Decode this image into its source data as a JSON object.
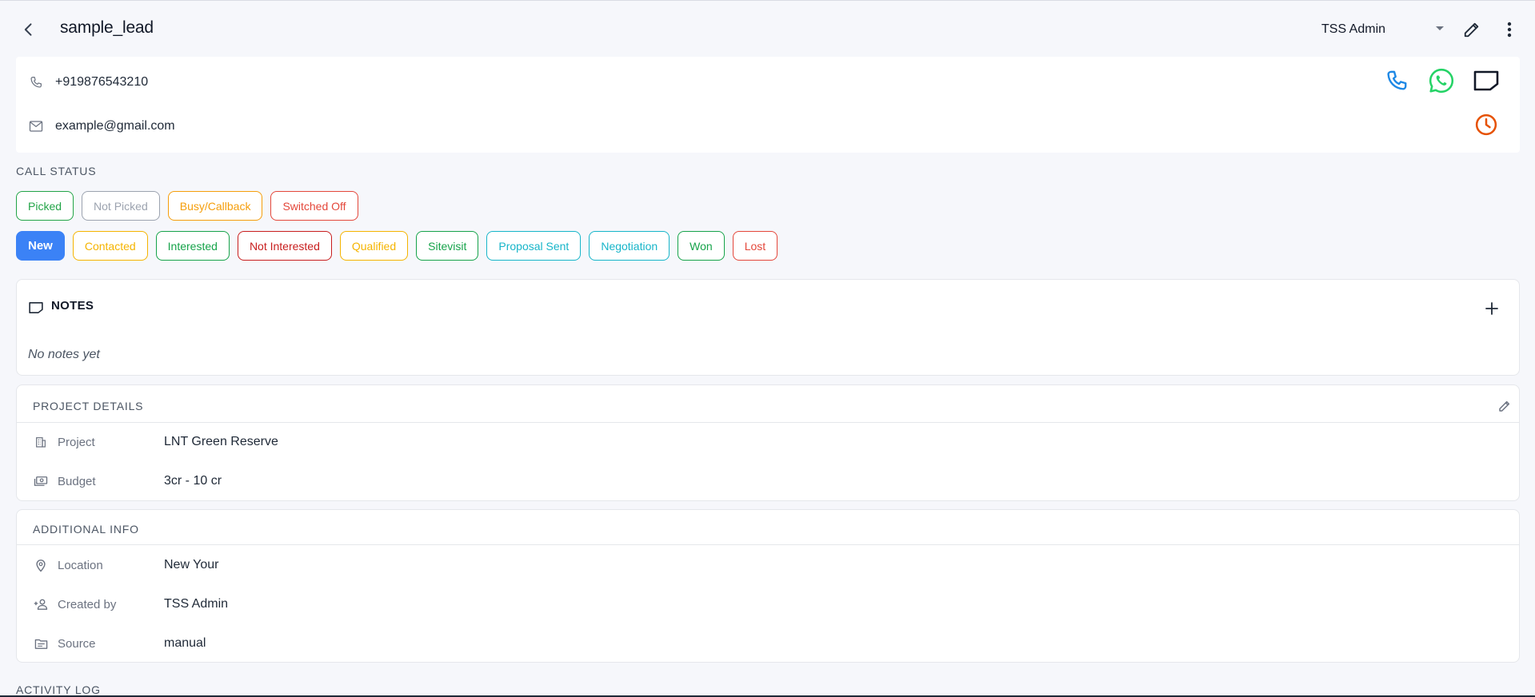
{
  "header": {
    "title": "sample_lead",
    "owner": "TSS Admin"
  },
  "contact": {
    "phone": "+919876543210",
    "email": "example@gmail.com"
  },
  "call_status": {
    "label": "CALL STATUS",
    "options": [
      {
        "label": "Picked",
        "color": "#22a447"
      },
      {
        "label": "Not Picked",
        "color": "#9ca3af"
      },
      {
        "label": "Busy/Callback",
        "color": "#f59e0b"
      },
      {
        "label": "Switched Off",
        "color": "#e4473a"
      }
    ]
  },
  "lead_status": {
    "options": [
      {
        "label": "New",
        "color": "#3b82f6",
        "selected": true
      },
      {
        "label": "Contacted",
        "color": "#f5b400"
      },
      {
        "label": "Interested",
        "color": "#16a34a"
      },
      {
        "label": "Not Interested",
        "color": "#c81e1e"
      },
      {
        "label": "Qualified",
        "color": "#f5b400"
      },
      {
        "label": "Sitevisit",
        "color": "#16a34a"
      },
      {
        "label": "Proposal Sent",
        "color": "#17b5c9"
      },
      {
        "label": "Negotiation",
        "color": "#17b5c9"
      },
      {
        "label": "Won",
        "color": "#16a34a"
      },
      {
        "label": "Lost",
        "color": "#e4473a"
      }
    ]
  },
  "notes": {
    "title": "NOTES",
    "empty_text": "No notes yet"
  },
  "project_details": {
    "title": "PROJECT DETAILS",
    "rows": [
      {
        "label": "Project",
        "value": "LNT Green Reserve",
        "icon": "building-icon"
      },
      {
        "label": "Budget",
        "value": "3cr - 10 cr",
        "icon": "money-icon"
      }
    ]
  },
  "additional_info": {
    "title": "ADDITIONAL INFO",
    "rows": [
      {
        "label": "Location",
        "value": "New Your",
        "icon": "location-pin-icon"
      },
      {
        "label": "Created by",
        "value": "TSS Admin",
        "icon": "person-add-icon"
      },
      {
        "label": "Source",
        "value": "manual",
        "icon": "source-icon"
      }
    ]
  },
  "activity_log": {
    "title": "ACTIVITY LOG"
  },
  "colors": {
    "call_icon": "#1e88e5",
    "whatsapp_icon": "#25d366",
    "reminder_icon": "#e65100",
    "selected_status": "#3b82f6"
  }
}
